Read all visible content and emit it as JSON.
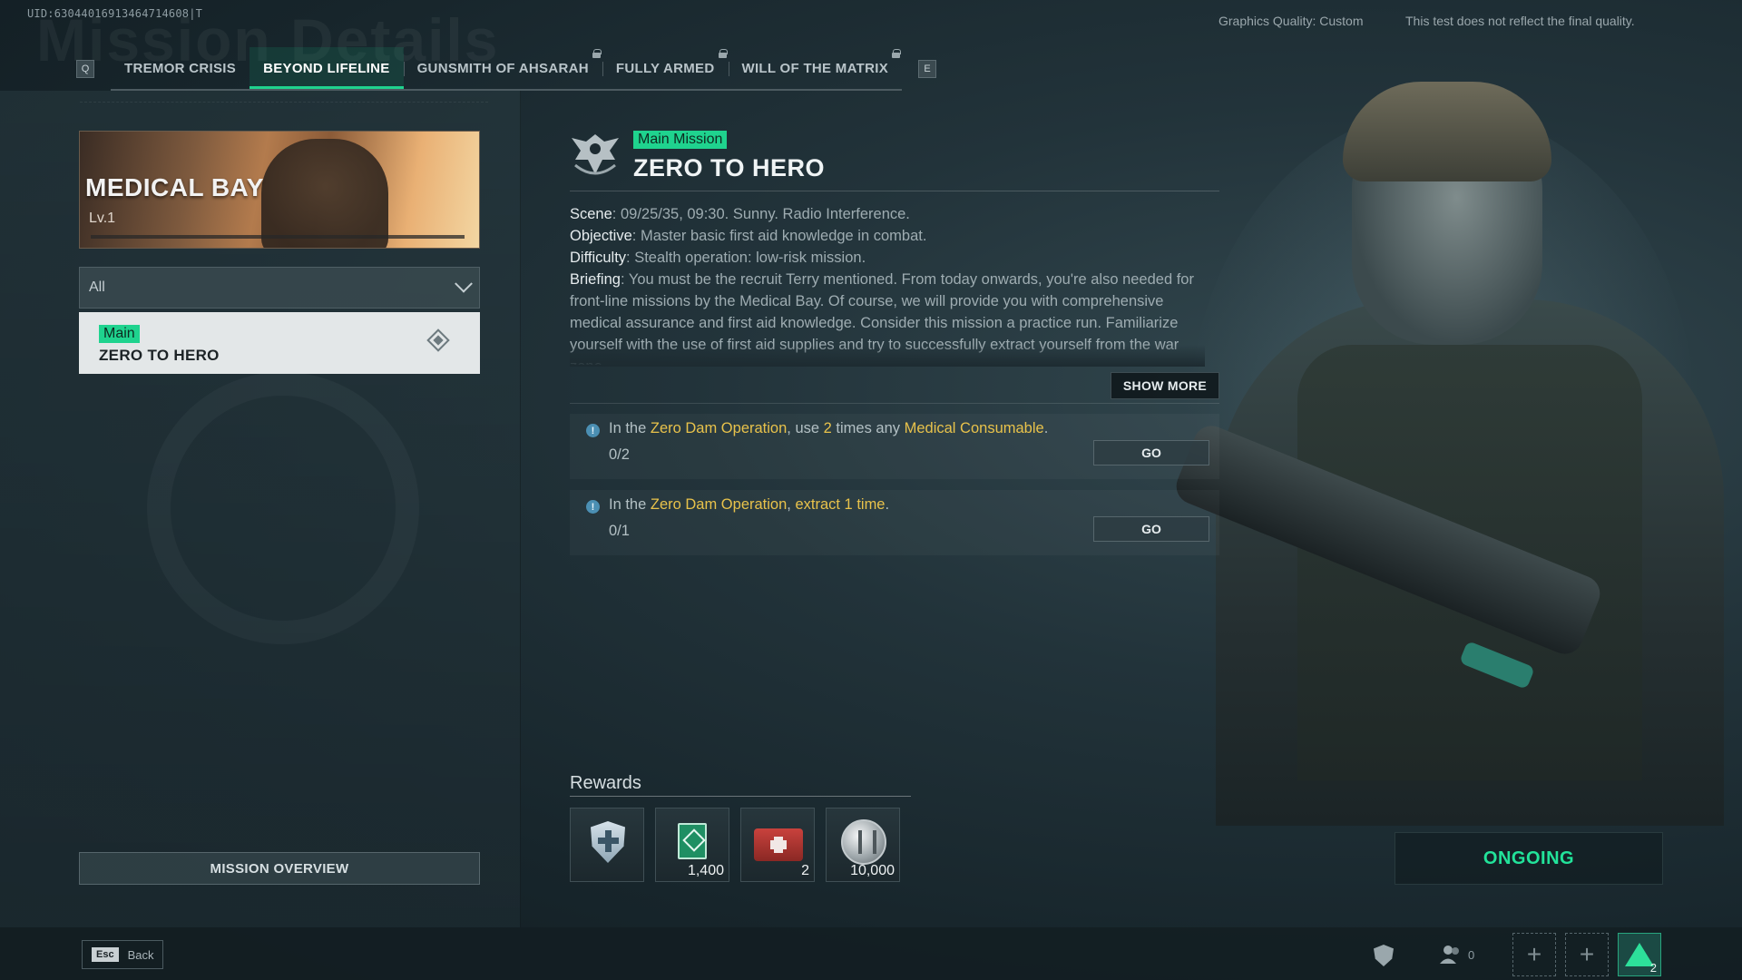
{
  "uid": "UID:63044016913464714608|T",
  "header": {
    "ghost_title": "Mission Details",
    "graphics_quality": "Graphics Quality: Custom",
    "disclaimer": "This test does not reflect the final quality."
  },
  "tabs": {
    "prev_key": "Q",
    "next_key": "E",
    "items": [
      {
        "label": "TREMOR CRISIS",
        "locked": false
      },
      {
        "label": "BEYOND LIFELINE",
        "locked": false,
        "active": true
      },
      {
        "label": "GUNSMITH OF AHSARAH",
        "locked": true
      },
      {
        "label": "FULLY ARMED",
        "locked": true
      },
      {
        "label": "WILL OF THE MATRIX",
        "locked": true
      }
    ]
  },
  "left_panel": {
    "banner": {
      "name": "MEDICAL BAY",
      "level": "Lv.1"
    },
    "filter": {
      "value": "All"
    },
    "mission_item": {
      "tag": "Main",
      "title": "ZERO TO HERO"
    },
    "overview_button": "MISSION OVERVIEW"
  },
  "mission": {
    "tag": "Main Mission",
    "title": "ZERO TO HERO",
    "scene_label": "Scene",
    "scene": ": 09/25/35, 09:30. Sunny. Radio Interference.",
    "objective_label": "Objective",
    "objective": ": Master basic first aid knowledge in combat.",
    "difficulty_label": "Difficulty",
    "difficulty": ": Stealth operation: low-risk mission.",
    "briefing_label": "Briefing",
    "briefing": ": You must be the recruit Terry mentioned. From today onwards, you're also needed for front-line missions by the Medical Bay. Of course, we will provide you with comprehensive medical assurance and first aid knowledge. Consider this mission a practice run. Familiarize yourself with the use of first aid supplies and try to successfully extract yourself from the war zone.",
    "show_more": "SHOW MORE"
  },
  "objectives": [
    {
      "text_1": "In the ",
      "hl_1": "Zero Dam Operation",
      "text_2": ", use ",
      "hl_2": "2",
      "text_3": " times any ",
      "hl_3": "Medical Consumable",
      "text_4": ".",
      "progress": "0/2",
      "button": "GO"
    },
    {
      "text_1": "In the ",
      "hl_1": "Zero Dam Operation",
      "text_2": ", ",
      "hl_2": "extract 1 time",
      "text_3": ".",
      "progress": "0/1",
      "button": "GO"
    }
  ],
  "rewards": {
    "label": "Rewards",
    "items": [
      {
        "icon": "shield-plus-icon",
        "qty": ""
      },
      {
        "icon": "book-icon",
        "qty": "1,400"
      },
      {
        "icon": "medkit-icon",
        "qty": "2"
      },
      {
        "icon": "coin-icon",
        "qty": "10,000"
      }
    ]
  },
  "status": "ONGOING",
  "bottom_bar": {
    "esc_key": "Esc",
    "back_label": "Back",
    "friend_count": "0",
    "squad_badge": "2"
  },
  "colors": {
    "accent": "#1fd38e",
    "highlight": "#e8c24b",
    "status": "#22e39a"
  }
}
